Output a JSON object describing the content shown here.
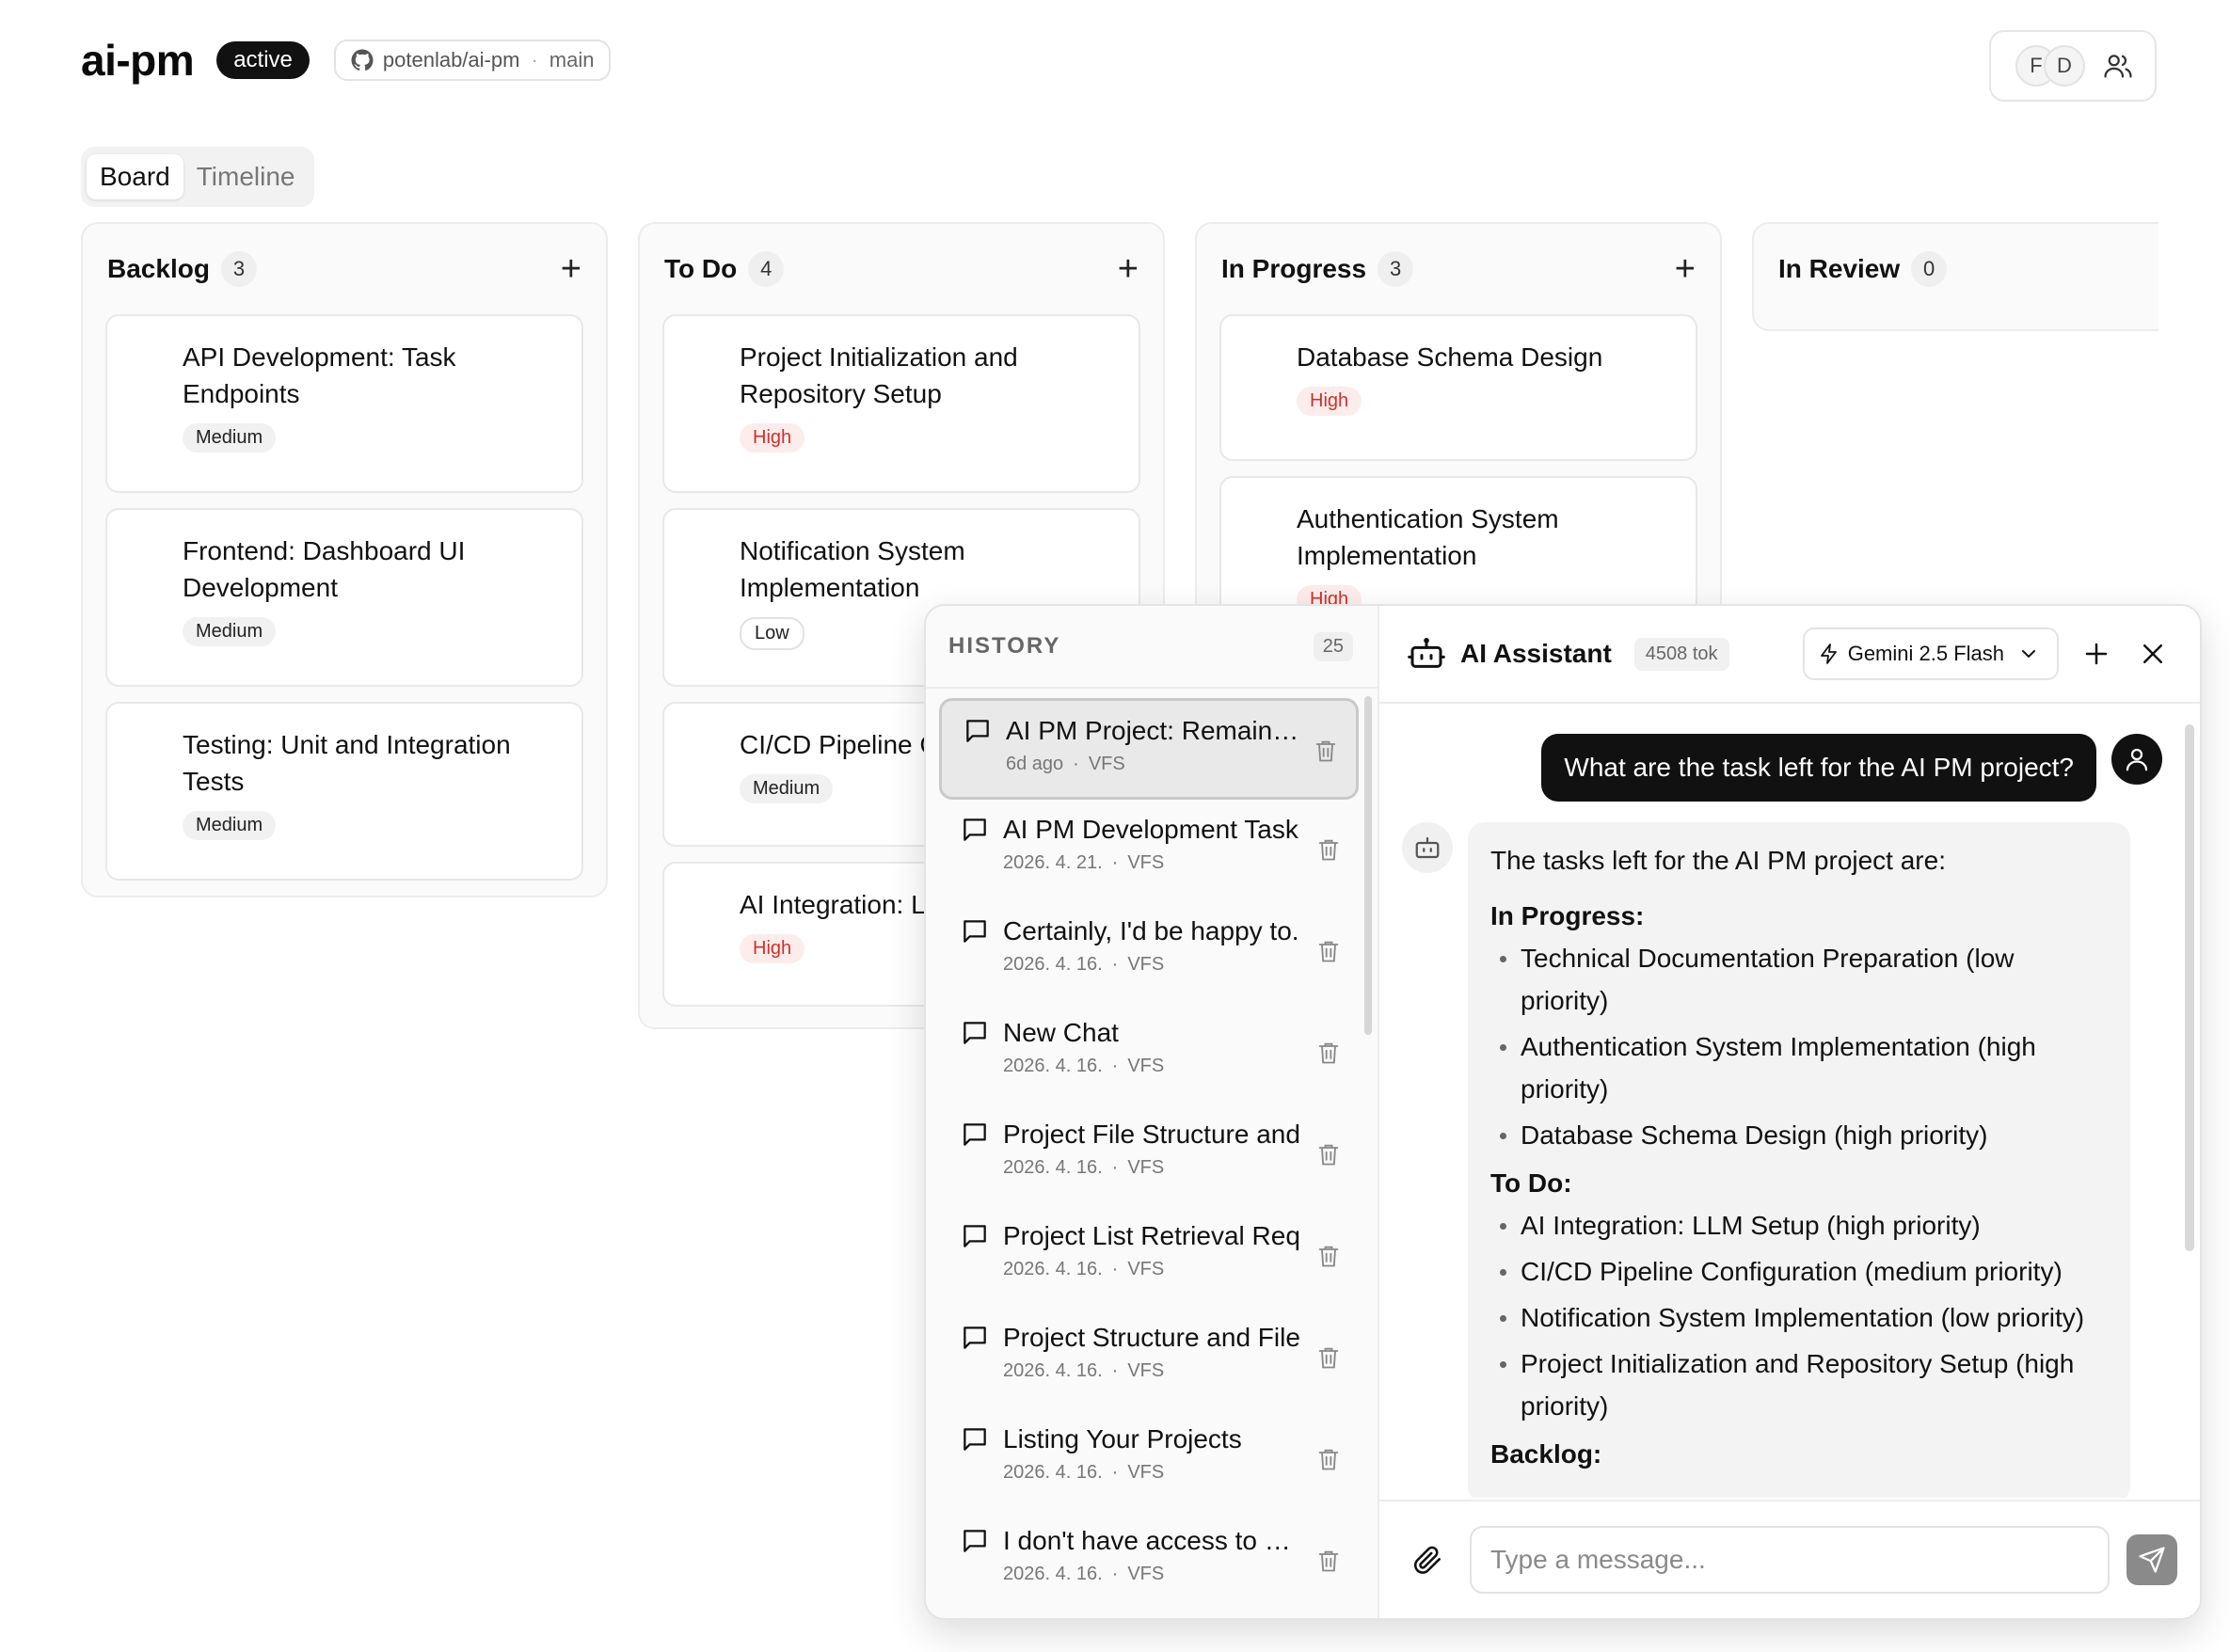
{
  "header": {
    "app_title": "ai-pm",
    "status": "active",
    "repo": "potenlab/ai-pm",
    "branch": "main",
    "avatars": [
      "F",
      "D"
    ]
  },
  "tabs": [
    {
      "label": "Board",
      "active": true
    },
    {
      "label": "Timeline",
      "active": false
    }
  ],
  "columns": [
    {
      "title": "Backlog",
      "count": "3",
      "add": "+",
      "cards": [
        {
          "title": "API Development: Task Endpoints",
          "priority": "Medium"
        },
        {
          "title": "Frontend: Dashboard UI Development",
          "priority": "Medium"
        },
        {
          "title": "Testing: Unit and Integration Tests",
          "priority": "Medium"
        }
      ]
    },
    {
      "title": "To Do",
      "count": "4",
      "add": "+",
      "cards": [
        {
          "title": "Project Initialization and Repository Setup",
          "priority": "High"
        },
        {
          "title": "Notification System Implementation",
          "priority": "Low"
        },
        {
          "title": "CI/CD Pipeline C",
          "priority": "Medium"
        },
        {
          "title": "AI Integration: L",
          "priority": "High"
        }
      ]
    },
    {
      "title": "In Progress",
      "count": "3",
      "add": "+",
      "cards": [
        {
          "title": "Database Schema Design",
          "priority": "High"
        },
        {
          "title": "Authentication System Implementation",
          "priority": "High"
        }
      ]
    },
    {
      "title": "In Review",
      "count": "0",
      "cards": []
    }
  ],
  "history": {
    "title": "HISTORY",
    "count": "25",
    "items": [
      {
        "title": "AI PM Project: Remaining",
        "date": "6d ago",
        "tag": "VFS",
        "selected": true
      },
      {
        "title": "AI PM Development Task",
        "date": "2026. 4. 21.",
        "tag": "VFS"
      },
      {
        "title": "Certainly, I'd be happy to.",
        "date": "2026. 4. 16.",
        "tag": "VFS"
      },
      {
        "title": "New Chat",
        "date": "2026. 4. 16.",
        "tag": "VFS"
      },
      {
        "title": "Project File Structure and",
        "date": "2026. 4. 16.",
        "tag": "VFS"
      },
      {
        "title": "Project List Retrieval Req",
        "date": "2026. 4. 16.",
        "tag": "VFS"
      },
      {
        "title": "Project Structure and File",
        "date": "2026. 4. 16.",
        "tag": "VFS"
      },
      {
        "title": "Listing Your Projects",
        "date": "2026. 4. 16.",
        "tag": "VFS"
      },
      {
        "title": "I don't have access to you",
        "date": "2026. 4. 16.",
        "tag": "VFS"
      }
    ]
  },
  "assistant": {
    "title": "AI Assistant",
    "tokens": "4508 tok",
    "model": "Gemini 2.5 Flash",
    "user_message": "What are the task left for the AI PM project?",
    "reply": {
      "intro": "The tasks left for the AI PM project are:",
      "sections": [
        {
          "heading": "In Progress:",
          "items": [
            "Technical Documentation Preparation (low priority)",
            "Authentication System Implementation (high priority)",
            "Database Schema Design (high priority)"
          ]
        },
        {
          "heading": "To Do:",
          "items": [
            "AI Integration: LLM Setup (high priority)",
            "CI/CD Pipeline Configuration (medium priority)",
            "Notification System Implementation (low priority)",
            "Project Initialization and Repository Setup (high priority)"
          ]
        },
        {
          "heading": "Backlog:",
          "items": []
        }
      ]
    },
    "input_placeholder": "Type a message..."
  }
}
